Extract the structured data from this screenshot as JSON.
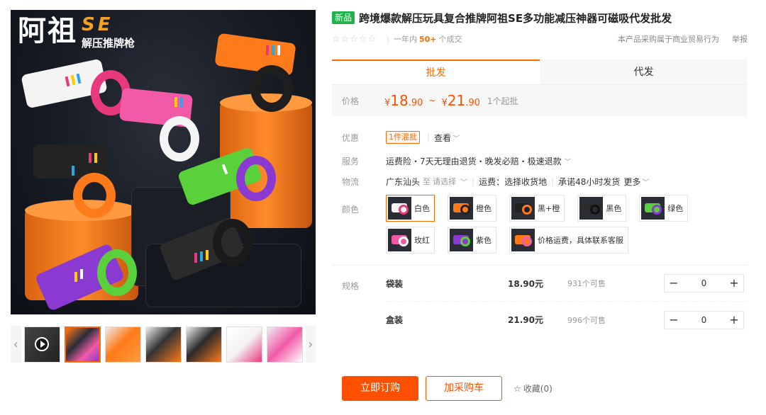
{
  "gallery": {
    "brand_name": "阿祖",
    "brand_se": "SE",
    "brand_sub": "解压推牌枪",
    "prev_arrow": "‹",
    "next_arrow": "›",
    "thumbnails": [
      {
        "kind": "video",
        "selected": false
      },
      {
        "kind": "image",
        "selected": true
      },
      {
        "kind": "image",
        "selected": false
      },
      {
        "kind": "image",
        "selected": false
      },
      {
        "kind": "image",
        "selected": false
      },
      {
        "kind": "image",
        "selected": false
      },
      {
        "kind": "image",
        "selected": false
      }
    ]
  },
  "product": {
    "badge": "新品",
    "title": "跨境爆款解压玩具复合推牌阿祖SE多功能减压神器可磁吸代发批发",
    "stars": "☆☆☆☆☆",
    "sold_prefix": "一年内",
    "sold_count": "50+",
    "sold_suffix": "个成交",
    "trade_note": "本产品采购属于商业贸易行为",
    "report": "举报"
  },
  "tabs": [
    {
      "label": "批发",
      "active": true
    },
    {
      "label": "代发",
      "active": false
    }
  ],
  "price": {
    "label": "价格",
    "currency": "¥",
    "low_int": "18",
    "low_dec": ".90",
    "range_sep": "~",
    "high_int": "21",
    "high_dec": ".90",
    "moq": "1个起批"
  },
  "promo": {
    "label": "优惠",
    "tag": "1件混批",
    "check": "查看"
  },
  "service": {
    "label": "服务",
    "text": "运费险・7天无理由退货・晚发必赔・极速退款"
  },
  "logistics": {
    "label": "物流",
    "origin": "广东汕头",
    "to": "至",
    "select": "请选择",
    "freight": "运费：选择收货地",
    "promise": "承诺48小时发货",
    "more": "更多"
  },
  "colors": {
    "label": "颜色",
    "options": [
      {
        "name": "白色",
        "body": "#f3f3f3",
        "ring": "#e8397d",
        "selected": true
      },
      {
        "name": "橙色",
        "body": "#ff7a1a",
        "ring": "#222222",
        "selected": false
      },
      {
        "name": "黑+橙",
        "body": "#222222",
        "ring": "#ff7a1a",
        "selected": false
      },
      {
        "name": "黑色",
        "body": "#2b2b2b",
        "ring": "#111111",
        "selected": false
      },
      {
        "name": "绿色",
        "body": "#5ad13a",
        "ring": "#8a3ad1",
        "selected": false
      },
      {
        "name": "玫红",
        "body": "#f25aa8",
        "ring": "#ffffff",
        "selected": false
      },
      {
        "name": "紫色",
        "body": "#8a3ad1",
        "ring": "#5ad13a",
        "selected": false
      },
      {
        "name": "价格运费，具体联系客服",
        "body": "#ff7a1a",
        "ring": "#f25aa8",
        "selected": false
      }
    ]
  },
  "specs": {
    "label": "规格",
    "rows": [
      {
        "name": "袋装",
        "price": "18.90元",
        "stock": "931个可售",
        "qty": "0"
      },
      {
        "name": "盒装",
        "price": "21.90元",
        "stock": "996个可售",
        "qty": "0"
      }
    ],
    "minus": "−",
    "plus": "+"
  },
  "actions": {
    "buy": "立即订购",
    "cart": "加采购车",
    "fav": "收藏(0)",
    "fav_icon": "☆"
  }
}
